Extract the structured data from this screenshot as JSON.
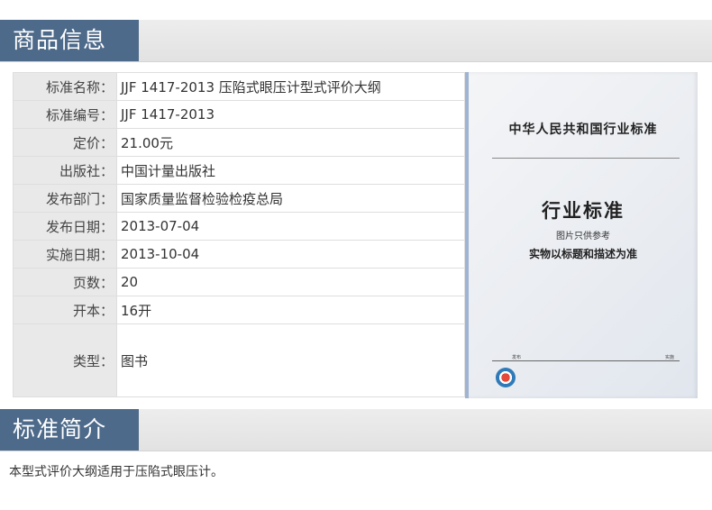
{
  "sections": {
    "info_title": "商品信息",
    "intro_title": "标准简介"
  },
  "rows": [
    {
      "label": "标准名称：",
      "value": "JJF 1417-2013 压陷式眼压计型式评价大纲"
    },
    {
      "label": "标准编号：",
      "value": "JJF 1417-2013"
    },
    {
      "label": "定价：",
      "value": "21.00元"
    },
    {
      "label": "出版社：",
      "value": "中国计量出版社"
    },
    {
      "label": "发布部门：",
      "value": "国家质量监督检验检疫总局"
    },
    {
      "label": "发布日期：",
      "value": "2013-07-04"
    },
    {
      "label": "实施日期：",
      "value": "2013-10-04"
    },
    {
      "label": "页数：",
      "value": "20"
    },
    {
      "label": "开本：",
      "value": "16开"
    },
    {
      "label": "类型：",
      "value": "图书"
    }
  ],
  "cover": {
    "header": "中华人民共和国行业标准",
    "main": "行业标准",
    "ref_note": "图片只供参考",
    "note": "实物以标题和描述为准",
    "publish": "发布",
    "implement": "实施"
  },
  "intro_text": "本型式评价大纲适用于压陷式眼压计。"
}
